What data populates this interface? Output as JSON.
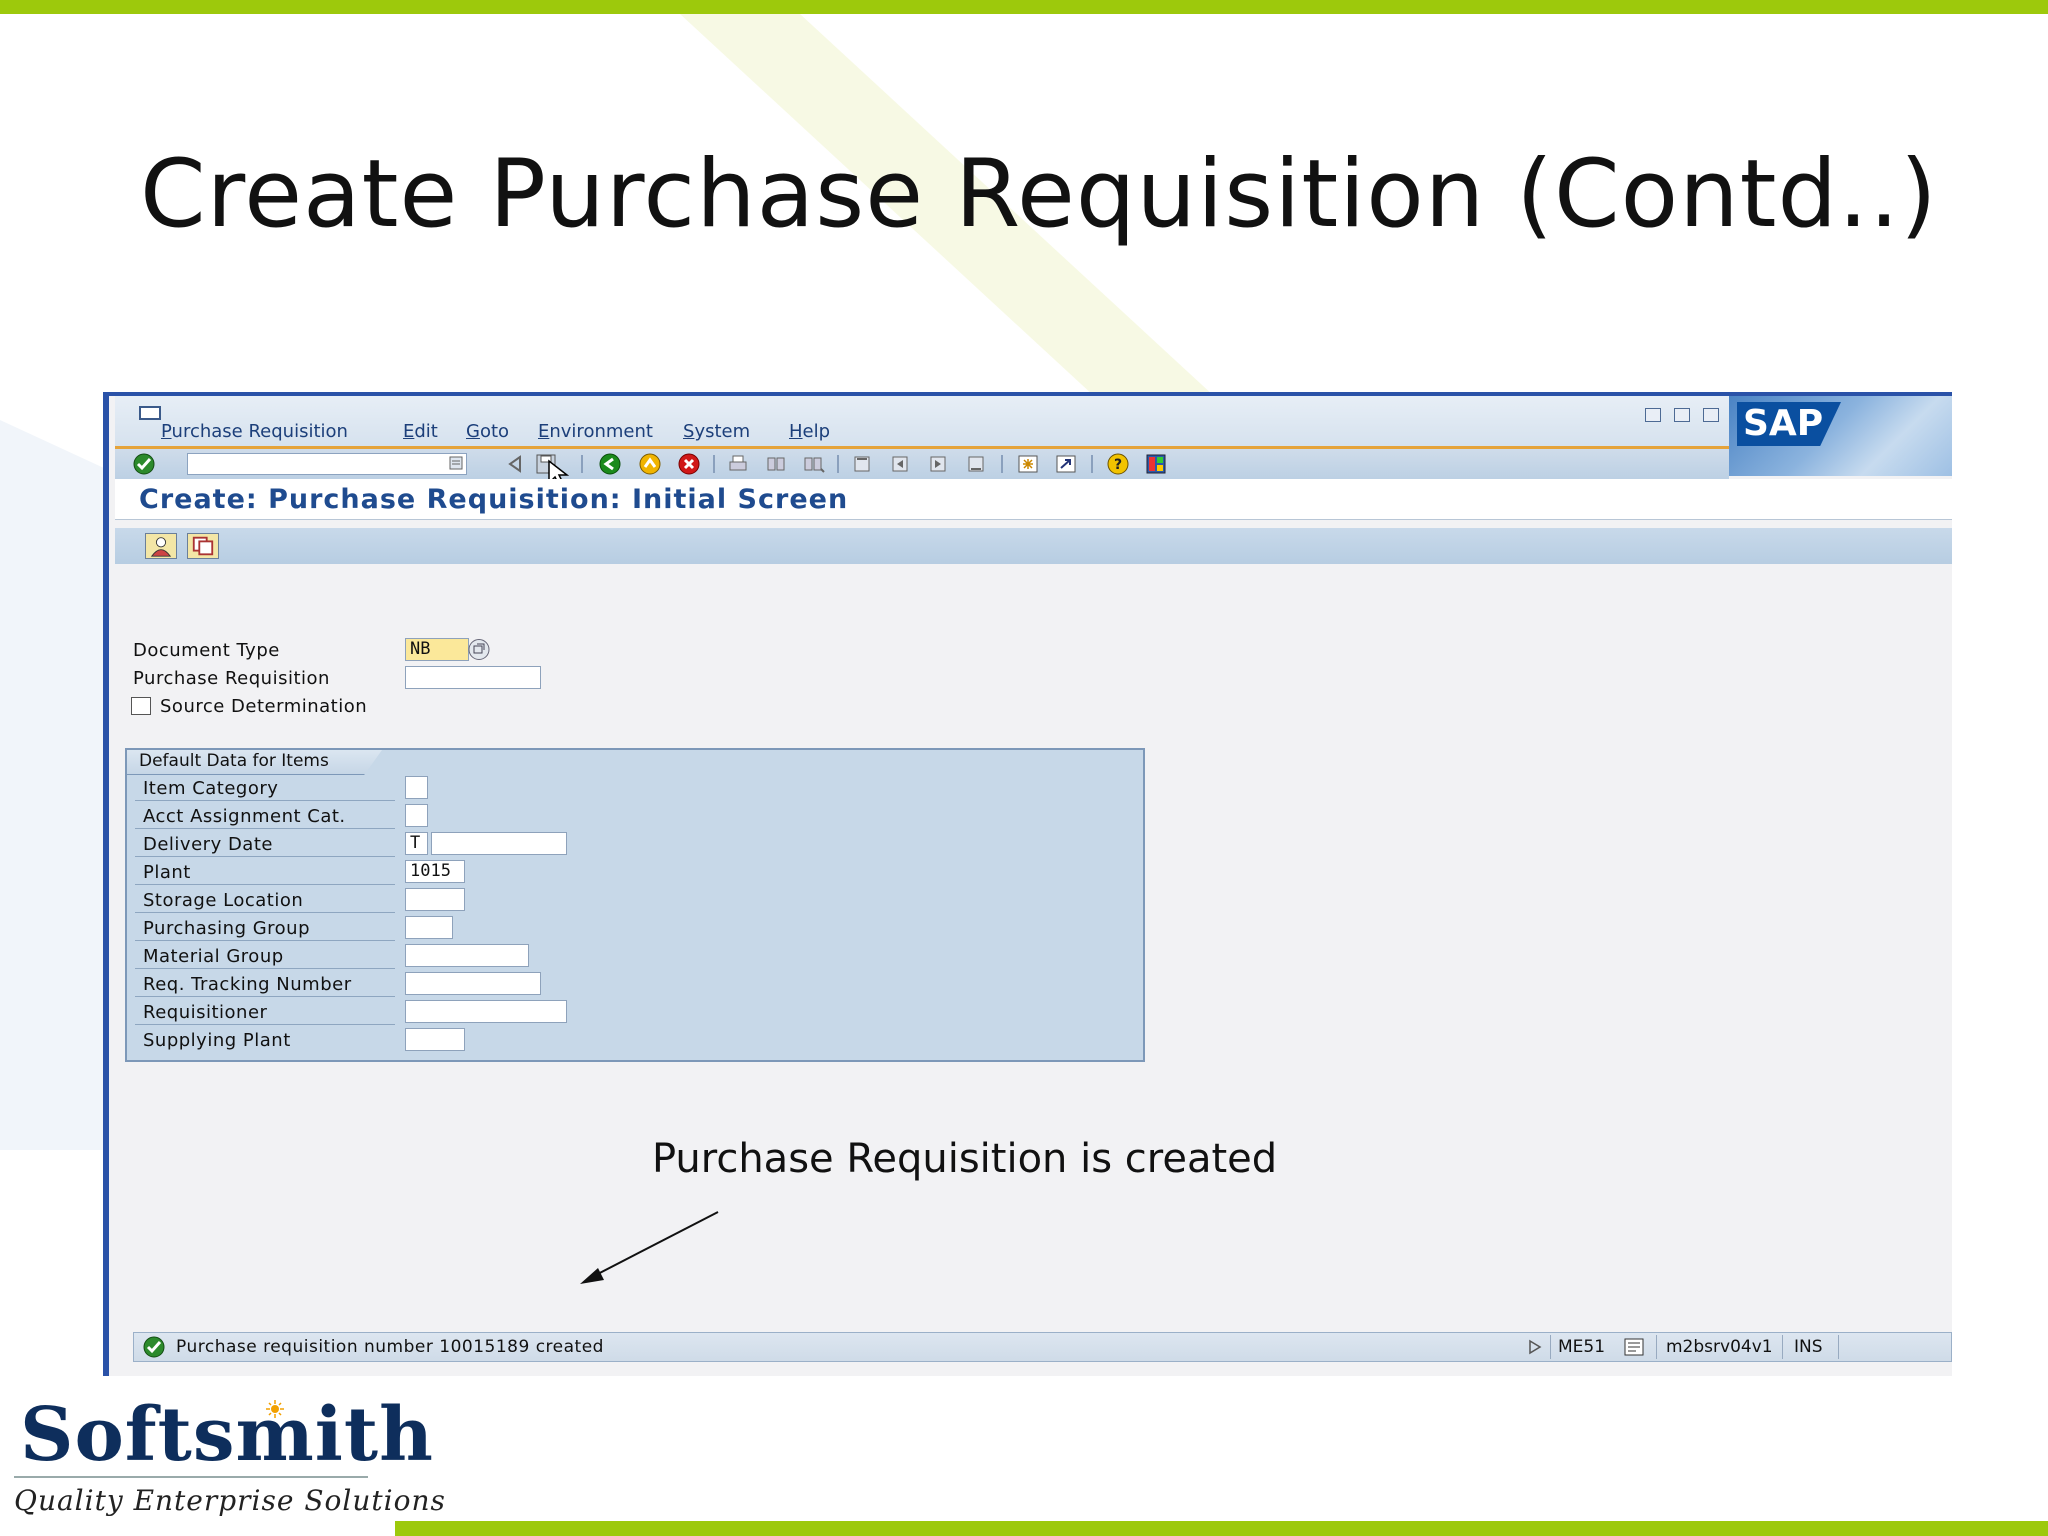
{
  "slide": {
    "title": "Create Purchase Requisition (Contd..)",
    "annotation": "Purchase Requisition is created",
    "logo_name": "Softsmith",
    "logo_tagline": "Quality Enterprise Solutions"
  },
  "sap": {
    "menu": [
      "Purchase Requisition",
      "Edit",
      "Goto",
      "Environment",
      "System",
      "Help"
    ],
    "brand": "SAP",
    "screen_title": "Create: Purchase Requisition: Initial Screen",
    "colors": {
      "title_blue": "#1f4b8f",
      "accent_green": "#9dc90c",
      "required_field": "#fbe89a"
    }
  },
  "form": {
    "document_type_label": "Document Type",
    "document_type_value": "NB",
    "purchase_requisition_label": "Purchase Requisition",
    "purchase_requisition_value": "",
    "source_determination_label": "Source Determination",
    "source_determination_checked": false
  },
  "defaults": {
    "group_title": "Default Data for Items",
    "item_category": "Item Category",
    "acct_assignment": "Acct Assignment Cat.",
    "delivery_date": "Delivery Date",
    "delivery_date_type": "T",
    "plant": "Plant",
    "plant_value": "1015",
    "storage_location": "Storage Location",
    "purchasing_group": "Purchasing Group",
    "material_group": "Material Group",
    "req_tracking": "Req. Tracking Number",
    "requisitioner": "Requisitioner",
    "supplying_plant": "Supplying Plant"
  },
  "status": {
    "message": "Purchase requisition number 10015189 created",
    "transaction": "ME51",
    "server": "m2bsrv04v1",
    "mode": "INS"
  }
}
